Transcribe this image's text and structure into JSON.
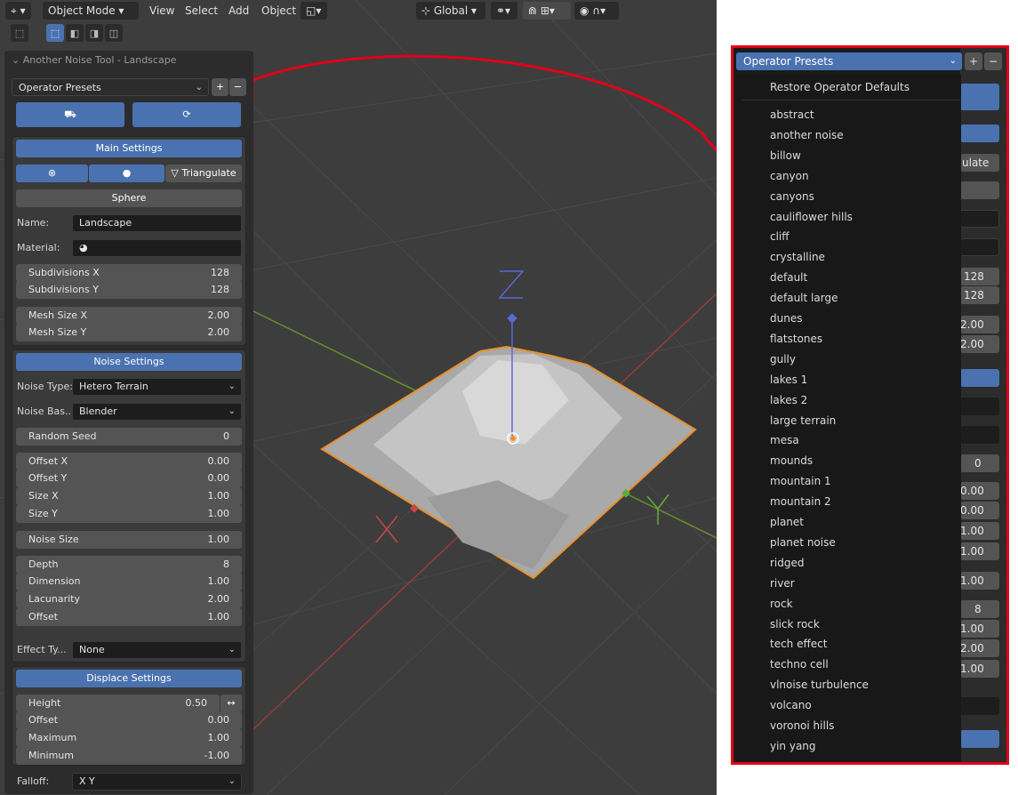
{
  "header": {
    "mode": "Object Mode",
    "menus": [
      "View",
      "Select",
      "Add",
      "Object"
    ],
    "orientation": "Global"
  },
  "panel": {
    "title": "Another Noise Tool - Landscape",
    "presets_label": "Operator Presets",
    "main_settings": "Main Settings",
    "triangulate": "Triangulate",
    "sphere": "Sphere",
    "name_label": "Name:",
    "name_value": "Landscape",
    "material_label": "Material:",
    "subdiv_x": {
      "label": "Subdivisions X",
      "value": "128"
    },
    "subdiv_y": {
      "label": "Subdivisions Y",
      "value": "128"
    },
    "mesh_x": {
      "label": "Mesh Size X",
      "value": "2.00"
    },
    "mesh_y": {
      "label": "Mesh Size Y",
      "value": "2.00"
    },
    "noise_settings": "Noise Settings",
    "noise_type_label": "Noise Type:",
    "noise_type": "Hetero Terrain",
    "noise_basis_label": "Noise Bas...",
    "noise_basis": "Blender",
    "random_seed": {
      "label": "Random Seed",
      "value": "0"
    },
    "offset_x": {
      "label": "Offset X",
      "value": "0.00"
    },
    "offset_y": {
      "label": "Offset Y",
      "value": "0.00"
    },
    "size_x": {
      "label": "Size X",
      "value": "1.00"
    },
    "size_y": {
      "label": "Size Y",
      "value": "1.00"
    },
    "noise_size": {
      "label": "Noise Size",
      "value": "1.00"
    },
    "depth": {
      "label": "Depth",
      "value": "8"
    },
    "dimension": {
      "label": "Dimension",
      "value": "1.00"
    },
    "lacunarity": {
      "label": "Lacunarity",
      "value": "2.00"
    },
    "offset": {
      "label": "Offset",
      "value": "1.00"
    },
    "effect_label": "Effect Ty...",
    "effect": "None",
    "displace_settings": "Displace Settings",
    "height": {
      "label": "Height",
      "value": "0.50"
    },
    "d_offset": {
      "label": "Offset",
      "value": "0.00"
    },
    "maximum": {
      "label": "Maximum",
      "value": "1.00"
    },
    "minimum": {
      "label": "Minimum",
      "value": "-1.00"
    },
    "falloff_label": "Falloff:",
    "falloff": "X Y"
  },
  "axes": {
    "x": "X",
    "y": "Y",
    "z": "Z"
  },
  "popup": {
    "presets_label": "Operator Presets",
    "restore": "Restore Operator Defaults",
    "items": [
      "abstract",
      "another noise",
      "billow",
      "canyon",
      "canyons",
      "cauliflower hills",
      "cliff",
      "crystalline",
      "default",
      "default large",
      "dunes",
      "flatstones",
      "gully",
      "lakes 1",
      "lakes 2",
      "large terrain",
      "mesa",
      "mounds",
      "mountain 1",
      "mountain 2",
      "planet",
      "planet noise",
      "ridged",
      "river",
      "rock",
      "slick rock",
      "tech effect",
      "techno cell",
      "vlnoise turbulence",
      "volcano",
      "voronoi hills",
      "yin yang"
    ],
    "behind": {
      "ulate": "ulate",
      "v128a": "128",
      "v128b": "128",
      "v200a": "2.00",
      "v200b": "2.00",
      "v0": "0",
      "v000a": "0.00",
      "v000b": "0.00",
      "v100a": "1.00",
      "v100b": "1.00",
      "v100c": "1.00",
      "v8": "8",
      "v100d": "1.00",
      "v200c": "2.00",
      "v100e": "1.00"
    }
  },
  "colors": {
    "accent": "#4a72b0",
    "annotation": "#e2001a"
  }
}
